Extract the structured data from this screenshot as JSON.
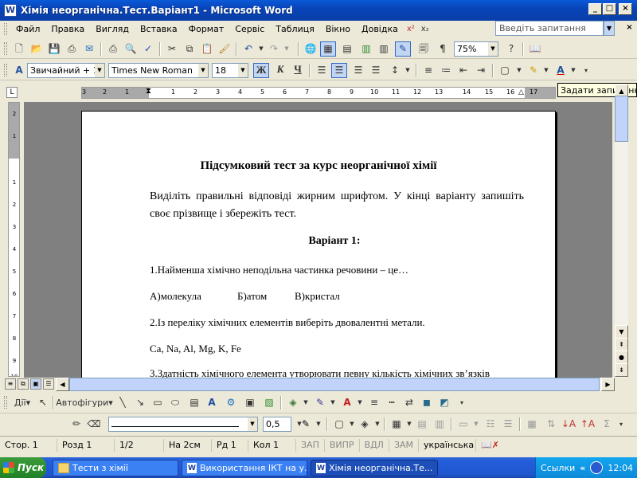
{
  "window": {
    "title": "Хімія неорганічна.Тест.Варіант1 - Microsoft Word",
    "app_icon": "W",
    "buttons": [
      "_",
      "□",
      "×"
    ]
  },
  "menu": {
    "items": [
      "Файл",
      "Правка",
      "Вигляд",
      "Вставка",
      "Формат",
      "Сервіс",
      "Таблиця",
      "Вікно",
      "Довідка"
    ],
    "extra_sup": "x²",
    "extra_sub": "x₂",
    "ask_placeholder": "Введіть запитання",
    "mdi_buttons": [
      "×"
    ]
  },
  "standard_toolbar": {
    "zoom": "75%"
  },
  "tooltip": "Задати запитання",
  "formatting_toolbar": {
    "style": "Звичайний + 18",
    "font": "Times New Roman",
    "size": "18",
    "bold": "Ж",
    "italic": "К",
    "underline": "Ч"
  },
  "ruler": {
    "ticks": [
      "3",
      "2",
      "1",
      "1",
      "2",
      "3",
      "4",
      "5",
      "6",
      "7",
      "8",
      "9",
      "10",
      "11",
      "12",
      "13",
      "14",
      "15",
      "16",
      "17"
    ],
    "vticks": [
      "2",
      "1",
      "1",
      "2",
      "3",
      "4",
      "5",
      "6",
      "7",
      "8",
      "9",
      "10"
    ]
  },
  "document": {
    "title": "Підсумковий тест за курс неорганічної хімії",
    "intro": "Виділіть правильні відповіді жирним шрифтом. У кінці варіанту запишіть своє прізвище і збережіть тест.",
    "variant": "Варіант 1:",
    "q1": "1.Найменша хімічно неподільна частинка речовини – це…",
    "q1_options": [
      "А)молекула",
      "Б)атом",
      "В)кристал"
    ],
    "q2": "2.Із переліку хімічних елементів виберіть двовалентні метали.",
    "q2_answer": "Ca, Na, Al, Mg, K, Fe",
    "q3": "3.Здатність хімічного елемента утворювати певну кількість хімічних зв’язків"
  },
  "drawing_toolbar": {
    "actions": "Дії",
    "autoshapes": "Автофігури",
    "line_width": "0,5"
  },
  "status": {
    "page": "Стор.  1",
    "section": "Розд  1",
    "pages": "1/2",
    "at": "На  2см",
    "line": "Рд  1",
    "col": "Кол  1",
    "rec": "ЗАП",
    "trk": "ВИПР",
    "ext": "ВДЛ",
    "ovr": "ЗАМ",
    "language": "українська"
  },
  "taskbar": {
    "start": "Пуск",
    "tasks": [
      {
        "label": "Тести з хімії",
        "icon": "folder"
      },
      {
        "label": "Використання ІКТ на у...",
        "icon": "word"
      },
      {
        "label": "Хімія неорганічна.Те...",
        "icon": "word"
      }
    ],
    "links": "Ссылки",
    "time": "12:04"
  },
  "colors": {
    "title_bar": "#0a5ad8",
    "doc_background": "#808080",
    "taskbar": "#245edb",
    "start_button": "#2d8f2d"
  }
}
